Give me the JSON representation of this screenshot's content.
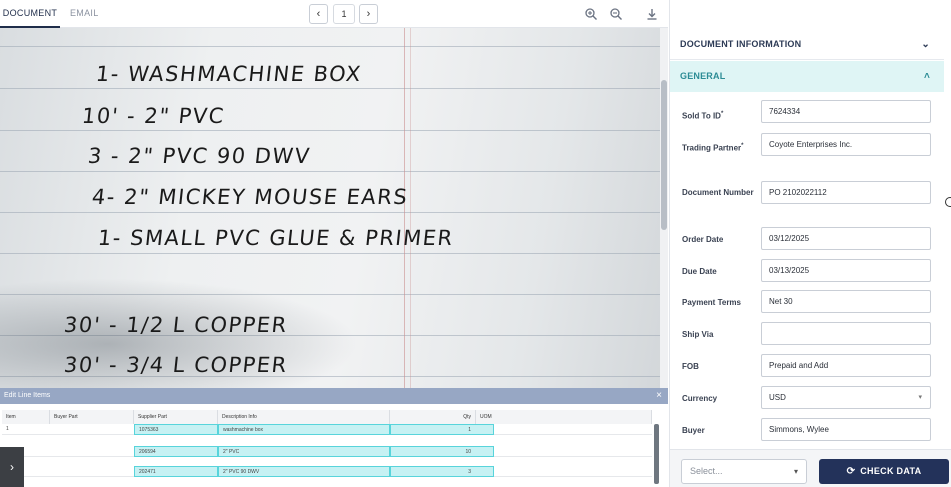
{
  "tabs": {
    "document": "DOCUMENT",
    "email": "EMAIL"
  },
  "pager": {
    "prev": "‹",
    "page": "1",
    "next": "›"
  },
  "toolbar": {
    "zoom_in": "zoom-in-icon",
    "zoom_out": "zoom-out-icon",
    "download": "download-icon"
  },
  "document": {
    "lines": [
      "1- WASHMACHINE BOX",
      "10' - 2\" PVC",
      "3 - 2\" PVC 90 DWV",
      "4- 2\" MICKEY MOUSE EARS",
      "1- SMALL PVC GLUE & PRIMER",
      "30' - 1/2 L COPPER",
      "30' - 3/4 L COPPER"
    ]
  },
  "line_items": {
    "title": "Edit Line Items",
    "close": "×",
    "columns": [
      "Item",
      "Buyer Part",
      "Supplier Part",
      "Description Info",
      "Qty",
      "UOM"
    ],
    "rows": [
      {
        "item": "1",
        "buyer_part": "",
        "supplier_part": "1075363",
        "description": "washmachine box",
        "qty": "1",
        "uom": ""
      },
      {
        "item": "",
        "buyer_part": "",
        "supplier_part": "206594",
        "description": "2\" PVC",
        "qty": "10",
        "uom": ""
      },
      {
        "item": "",
        "buyer_part": "",
        "supplier_part": "202471",
        "description": "2\" PVC 90 DWV",
        "qty": "3",
        "uom": ""
      }
    ]
  },
  "panel": {
    "document_information": "DOCUMENT INFORMATION",
    "general": "GENERAL",
    "fields": [
      {
        "label": "Sold To ID",
        "required": true,
        "value": "7624334"
      },
      {
        "label": "Trading Partner",
        "required": true,
        "value": "Coyote Enterprises Inc."
      },
      {
        "label": "Document Number",
        "required": false,
        "value": "PO 2102022112"
      },
      {
        "label": "Order Date",
        "required": false,
        "value": "03/12/2025"
      },
      {
        "label": "Due Date",
        "required": false,
        "value": "03/13/2025"
      },
      {
        "label": "Payment Terms",
        "required": false,
        "value": "Net 30"
      },
      {
        "label": "Ship Via",
        "required": false,
        "value": ""
      },
      {
        "label": "FOB",
        "required": false,
        "value": "Prepaid and Add"
      },
      {
        "label": "Currency",
        "required": false,
        "value": "USD"
      },
      {
        "label": "Buyer",
        "required": false,
        "value": "Simmons, Wylee"
      }
    ],
    "select_placeholder": "Select...",
    "check_data": "CHECK DATA"
  },
  "colors": {
    "primary": "#23325a",
    "accent": "#2c8c95",
    "highlight": "#c6f1f3"
  }
}
